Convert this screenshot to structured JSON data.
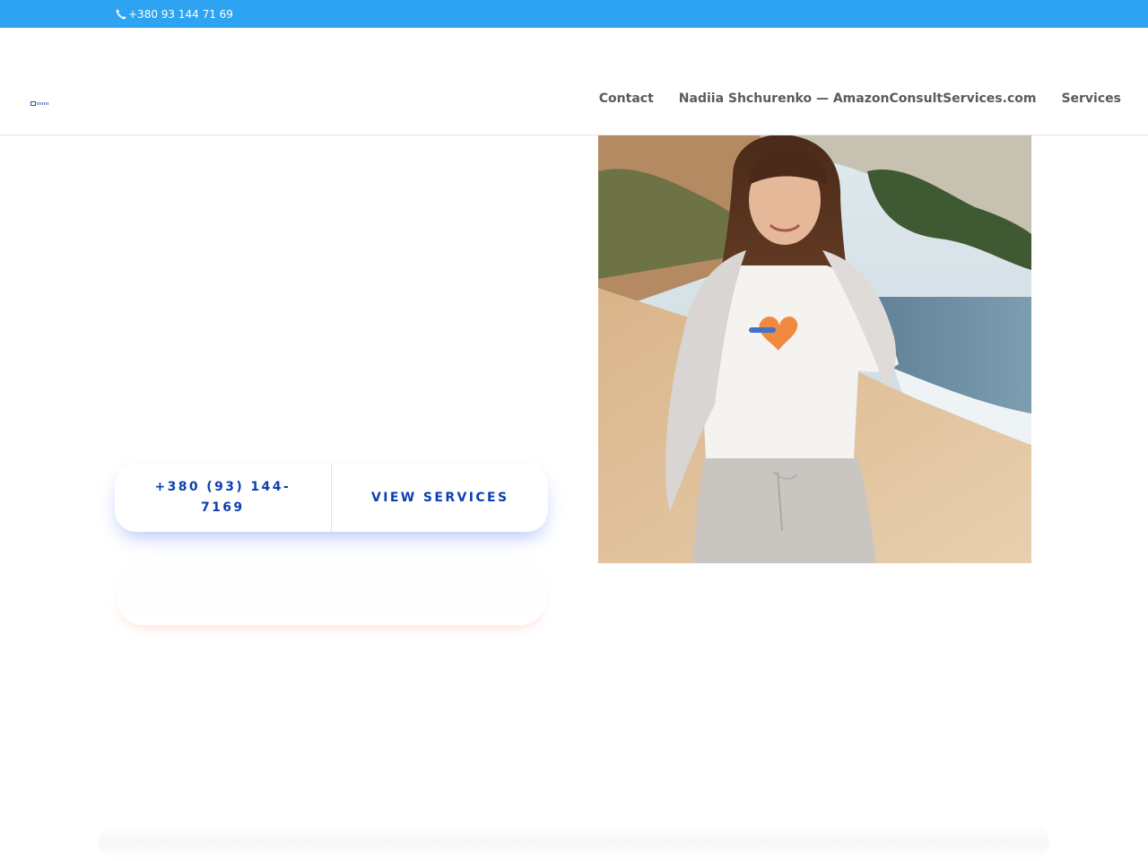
{
  "topbar": {
    "phone": "+380 93 144 71 69",
    "phone_icon": "phone-icon",
    "background": "#2ea3f2"
  },
  "header": {
    "nav": [
      {
        "label": "Contact"
      },
      {
        "label": "Nadiia Shchurenko — AmazonConsultServices.com"
      },
      {
        "label": "Services"
      }
    ]
  },
  "hero": {
    "photo": "woman-on-beach-photo"
  },
  "buttons": {
    "phone_label": "+380 (93) 144-7169",
    "services_label": "VIEW SERVICES",
    "text_color": "#0c3fb0"
  }
}
